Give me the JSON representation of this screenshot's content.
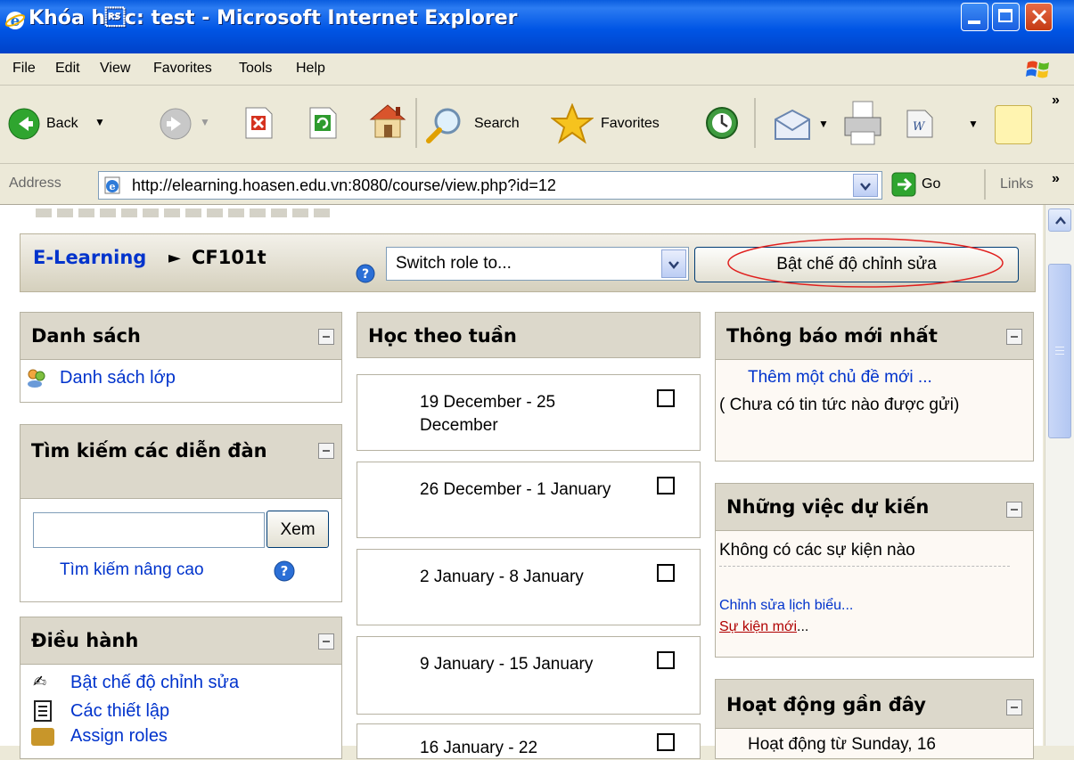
{
  "window": {
    "title": "Khóa h\u001ec: test - Microsoft Internet Explorer"
  },
  "menu": [
    "File",
    "Edit",
    "View",
    "Favorites",
    "Tools",
    "Help"
  ],
  "toolbar": {
    "back_label": "Back",
    "search_label": "Search",
    "favorites_label": "Favorites",
    "chevron": "»"
  },
  "address": {
    "label": "Address",
    "url": "http://elearning.hoasen.edu.vn:8080/course/view.php?id=12",
    "go_label": "Go",
    "links_label": "Links",
    "chevron": "»"
  },
  "nav": {
    "home": "E-Learning",
    "separator": "►",
    "course": "CF101t",
    "switch_role": "Switch role to...",
    "edit_button": "Bật chế độ chỉnh sửa"
  },
  "left": {
    "list_title": "Danh sách",
    "list_item": "Danh sách lớp",
    "search_title": "Tìm kiếm các diễn đàn",
    "search_button": "Xem",
    "advanced_search": "Tìm kiếm nâng cao",
    "admin_title": "Điều hành",
    "admin_items": [
      "Bật chế độ chỉnh sửa",
      "Các thiết lập",
      "Assign roles"
    ]
  },
  "center": {
    "title": "Học theo tuần",
    "weeks": [
      "19 December - 25 December",
      "26 December - 1 January",
      "2 January - 8 January",
      "9 January - 15 January",
      "16 January - 22"
    ]
  },
  "right": {
    "news_title": "Thông báo mới nhất",
    "news_add": "Thêm một chủ đề mới ...",
    "news_empty": "( Chưa có tin tức nào được gửi)",
    "upcoming_title": "Những việc dự kiến",
    "upcoming_empty": "Không có các sự kiện nào",
    "calendar_edit": "Chỉnh sửa lịch biểu...",
    "new_event_link": "Sự kiện mới",
    "new_event_suffix": "...",
    "recent_title": "Hoạt động gần đây",
    "recent_text": "Hoạt động từ Sunday, 16"
  }
}
